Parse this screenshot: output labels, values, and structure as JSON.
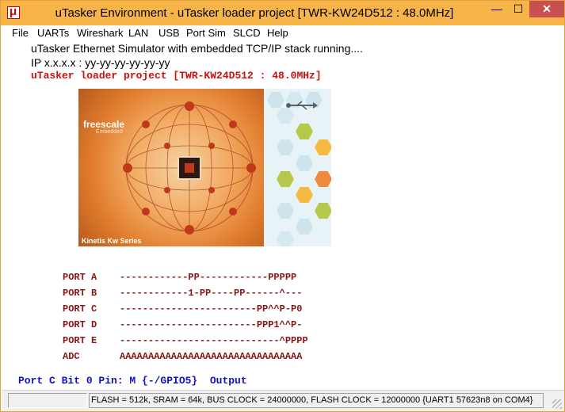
{
  "window": {
    "title": "uTasker Environment - uTasker loader project [TWR-KW24D512 : 48.0MHz]",
    "app_icon": "utasker-logo-icon",
    "controls": {
      "minimize": "—",
      "maximize": "☐",
      "close": "✕"
    }
  },
  "menu": [
    {
      "label": "File"
    },
    {
      "label": "UARTs"
    },
    {
      "label": "Wireshark"
    },
    {
      "label": "LAN"
    },
    {
      "label": "USB"
    },
    {
      "label": "Port Sim"
    },
    {
      "label": "SLCD"
    },
    {
      "label": "Help"
    }
  ],
  "header": {
    "line1": "uTasker Ethernet Simulator with embedded TCP/IP stack running....",
    "line2": "IP x.x.x.x : yy-yy-yy-yy-yy-yy",
    "line3": "uTasker loader project [TWR-KW24D512 : 48.0MHz]"
  },
  "splash": {
    "brand": "freescale",
    "sub": "Embedded",
    "caption": "Kinetis Kw Series"
  },
  "ports": [
    {
      "name": "PORT A",
      "pins": "------------PP------------PPPPP"
    },
    {
      "name": "PORT B",
      "pins": "------------1-PP----PP------^---"
    },
    {
      "name": "PORT C",
      "pins": "------------------------PP^^P-P0"
    },
    {
      "name": "PORT D",
      "pins": "------------------------PPP1^^P-"
    },
    {
      "name": "PORT E",
      "pins": "----------------------------^PPPP"
    },
    {
      "name": "ADC",
      "pins": "AAAAAAAAAAAAAAAAAAAAAAAAAAAAAAAA"
    }
  ],
  "pin_status": "Port C Bit 0 Pin: M {-/GPIO5}  Output",
  "statusbar": {
    "info": "FLASH = 512k, SRAM = 64k, BUS CLOCK = 24000000, FLASH CLOCK = 12000000 {UART1 57623n8 on COM4}"
  },
  "colors": {
    "titlebar": "#f6b449",
    "project_text": "#cc1010",
    "port_text": "#8a1414",
    "pin_status_text": "#1010c8"
  }
}
